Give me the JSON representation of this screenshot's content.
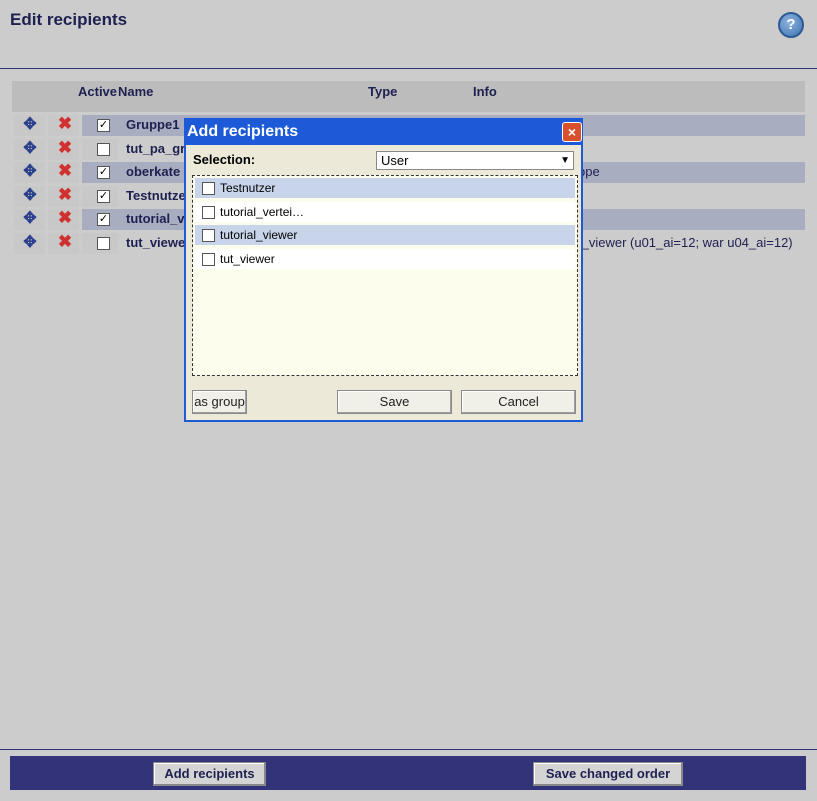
{
  "page": {
    "title": "Edit recipients",
    "help_label": "?"
  },
  "table": {
    "headers": {
      "active": "Active",
      "name": "Name",
      "type": "Type",
      "info": "Info"
    },
    "rows": [
      {
        "name": "Gruppe1",
        "active": true,
        "info": ""
      },
      {
        "name": "tut_pa_gr",
        "active": false,
        "info": ""
      },
      {
        "name": "oberkate",
        "active": true,
        "info": "ppe"
      },
      {
        "name": "Testnutze",
        "active": true,
        "info": ""
      },
      {
        "name": "tutorial_v",
        "active": true,
        "info": ""
      },
      {
        "name": "tut_viewe",
        "active": false,
        "info": "t_viewer (u01_ai=12; war u04_ai=12)"
      }
    ]
  },
  "dialog": {
    "title": "Add recipients",
    "close_label": "×",
    "selection_label": "Selection:",
    "selection_value": "User",
    "items": [
      {
        "label": "Testnutzer",
        "checked": false
      },
      {
        "label": "tutorial_vertei…",
        "checked": false
      },
      {
        "label": "tutorial_viewer",
        "checked": false
      },
      {
        "label": "tut_viewer",
        "checked": false
      }
    ],
    "as_group_label": "as group",
    "save_label": "Save",
    "cancel_label": "Cancel"
  },
  "footer": {
    "add_label": "Add recipients",
    "save_order_label": "Save changed order",
    "bar_color": "#33337a"
  },
  "icons": {
    "move": "move-icon",
    "delete": "delete-icon",
    "help": "help-icon"
  }
}
